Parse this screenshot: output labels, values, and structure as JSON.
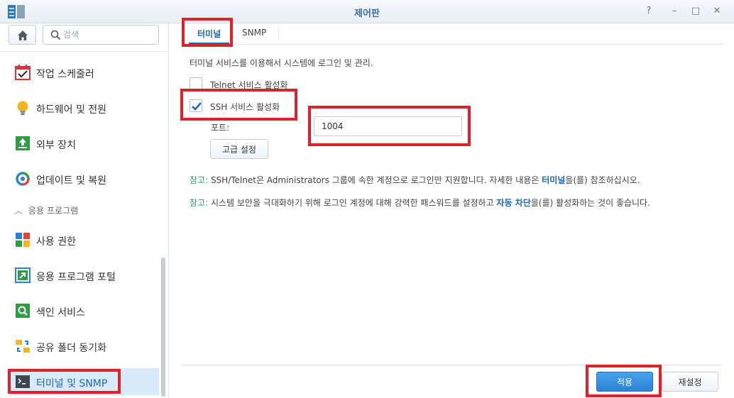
{
  "window": {
    "title": "제어판",
    "help_glyph": "?",
    "minimize_glyph": "–",
    "maximize_glyph": "□",
    "close_glyph": "✕"
  },
  "sidebar": {
    "search_placeholder": "검색",
    "section_label": "응용 프로그램",
    "items": [
      {
        "label": "작업 스케줄러",
        "icon": "task-scheduler-icon"
      },
      {
        "label": "하드웨어 및 전원",
        "icon": "lightbulb-icon"
      },
      {
        "label": "외부 장치",
        "icon": "external-device-icon"
      },
      {
        "label": "업데이트 및 복원",
        "icon": "update-restore-icon"
      },
      {
        "label": "사용 권한",
        "icon": "privileges-icon"
      },
      {
        "label": "응용 프로그램 포털",
        "icon": "application-portal-icon"
      },
      {
        "label": "색인 서비스",
        "icon": "indexing-service-icon"
      },
      {
        "label": "공유 폴더 동기화",
        "icon": "shared-folder-sync-icon"
      },
      {
        "label": "터미널 및 SNMP",
        "icon": "terminal-icon",
        "active": true
      }
    ]
  },
  "tabs": [
    {
      "label": "터미널",
      "active": true
    },
    {
      "label": "SNMP",
      "active": false
    }
  ],
  "terminal": {
    "description": "터미널 서비스를 이용해서 시스템에 로그인 및 관리.",
    "telnet_label": "Telnet 서비스 활성화",
    "telnet_checked": false,
    "ssh_label": "SSH 서비스 활성화",
    "ssh_checked": true,
    "port_label": "포트:",
    "port_value": "1004",
    "advanced_button": "고급 설정",
    "note1_prefix": "참고:",
    "note1_text": " SSH/Telnet은 Administrators 그룹에 속한 계정으로 로그인만 지원합니다. 자세한 내용은 ",
    "note1_link": "터미널",
    "note1_suffix": "을(를) 참조하십시오.",
    "note2_prefix": "참고:",
    "note2_text": " 시스템 보안을 극대화하기 위해 로그인 계정에 대해 강력한 패스워드를 설정하고 ",
    "note2_link": "자동 차단",
    "note2_suffix": "을(를) 활성화하는 것이 좋습니다."
  },
  "footer": {
    "apply_label": "적용",
    "reset_label": "재설정"
  },
  "colors": {
    "accent": "#1d68b3",
    "note_green": "#2e9e69",
    "annotation_red": "#e0202a"
  }
}
